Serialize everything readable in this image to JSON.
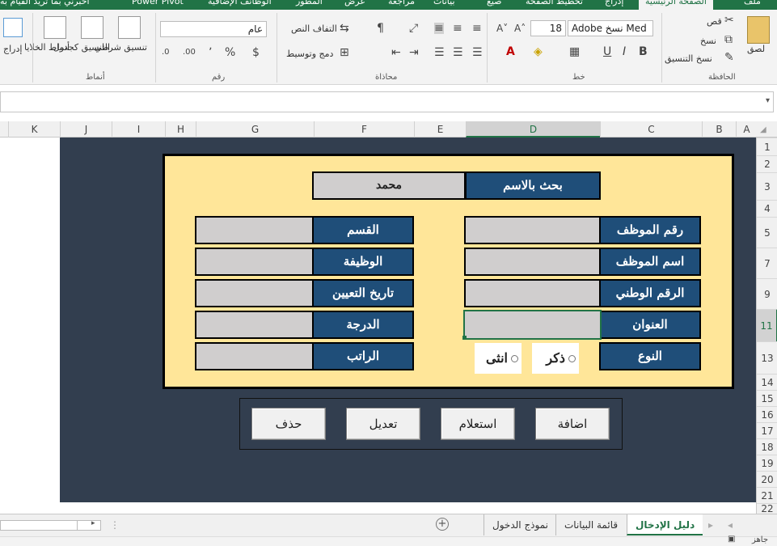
{
  "ribbon_tabs": {
    "file": "ملف",
    "home": "الصفحة الرئيسية",
    "insert": "إدراج",
    "page_layout": "تخطيط الصفحة",
    "formulas": "صيغ",
    "data": "بيانات",
    "review": "مراجعة",
    "view": "عرض",
    "developer": "المطور",
    "addins": "الوظائف الإضافية",
    "power_pivot": "Power Pivot",
    "tell_me": "أخبرني بما تريد القيام به"
  },
  "clipboard": {
    "paste": "لصق",
    "cut": "قص",
    "copy": "نسخ",
    "format_painter": "نسخ التنسيق",
    "group": "الحافظة"
  },
  "font": {
    "name": "Adobe نسخ Med",
    "size": "18",
    "bold": "B",
    "italic": "I",
    "underline": "U",
    "group": "خط"
  },
  "alignment": {
    "wrap_text": "التفاف النص",
    "merge_center": "دمج وتوسيط",
    "group": "محاذاة"
  },
  "number": {
    "format": "عام",
    "currency": "$",
    "percent": "%",
    "comma": "٬",
    "group": "رقم"
  },
  "styles": {
    "conditional": "تنسيق شرطي",
    "as_table": "التنسيق كجدول",
    "cell_styles": "أنماط الخلايا",
    "group": "أنماط"
  },
  "cells": {
    "insert": "إدراج"
  },
  "columns": [
    "A",
    "B",
    "C",
    "D",
    "E",
    "F",
    "G",
    "H",
    "I",
    "J",
    "K"
  ],
  "rows": [
    "1",
    "2",
    "3",
    "4",
    "5",
    "7",
    "9",
    "11",
    "13",
    "14",
    "15",
    "16",
    "17",
    "18",
    "19",
    "20",
    "21",
    "22"
  ],
  "form": {
    "search_label": "بحث بالاسم",
    "search_value": "محمد",
    "employee_no": "رقم الموظف",
    "employee_name": "اسم الموظف",
    "national_id": "الرقم الوطني",
    "address": "العنوان",
    "gender": "النوع",
    "department": "القسم",
    "job": "الوظيفة",
    "hire_date": "تاريخ التعيين",
    "grade": "الدرجة",
    "salary": "الراتب",
    "male": "ذكر",
    "female": "انثى"
  },
  "buttons": {
    "add": "اضافة",
    "query": "استعلام",
    "edit": "تعديل",
    "delete": "حذف"
  },
  "sheets": {
    "input_guide": "دليل الإدخال",
    "data_list": "قائمة البيانات",
    "login_form": "نموذج الدخول"
  },
  "status": {
    "ready": "جاهز"
  },
  "colors": {
    "excel_green": "#217346",
    "dark_bg": "#323e4f",
    "panel_bg": "#ffe699",
    "label_blue": "#1f4e79",
    "field_gray": "#d0cece"
  }
}
